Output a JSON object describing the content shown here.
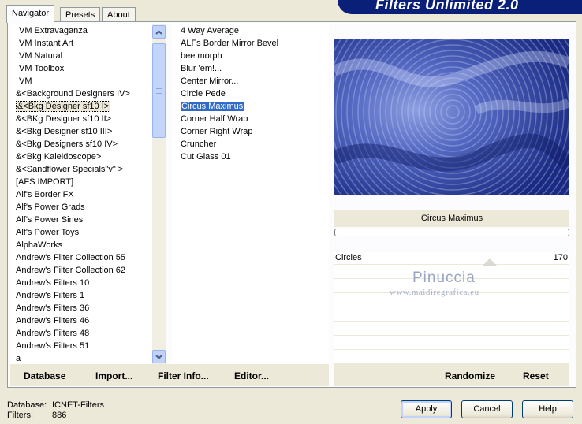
{
  "tabs": [
    {
      "label": "Navigator",
      "active": true
    },
    {
      "label": "Presets",
      "active": false
    },
    {
      "label": "About",
      "active": false
    }
  ],
  "banner": {
    "title": "Filters Unlimited 2.0"
  },
  "categories": [
    "VM Extravaganza",
    "VM Instant Art",
    "VM Natural",
    "VM Toolbox",
    "VM",
    "&<Background Designers IV>",
    "&<Bkg Designer sf10 I>",
    "&<BKg Designer sf10 II>",
    "&<Bkg Designer sf10 III>",
    "&<Bkg Designers sf10 IV>",
    "&<Bkg Kaleidoscope>",
    "&<Sandflower Specials\"v\" >",
    "[AFS IMPORT]",
    "Alf's Border FX",
    "Alf's Power Grads",
    "Alf's Power Sines",
    "Alf's Power Toys",
    "AlphaWorks",
    "Andrew's Filter Collection 55",
    "Andrew's Filter Collection 62",
    "Andrew's Filters 10",
    "Andrew's Filters 1",
    "Andrew's Filters 36",
    "Andrew's Filters 46",
    "Andrew's Filters 48",
    "Andrew's Filters 51",
    "a"
  ],
  "selected_category": "&<Bkg Designer sf10 I>",
  "filters": [
    "4 Way Average",
    "ALFs Border Mirror Bevel",
    "bee morph",
    "Blur 'em!...",
    "Center Mirror...",
    "Circle Pede",
    "Circus Maximus",
    "Corner Half Wrap",
    "Corner Right Wrap",
    "Cruncher",
    "Cut Glass 01"
  ],
  "selected_filter": "Circus Maximus",
  "preview": {
    "filter_name": "Circus Maximus"
  },
  "params": [
    {
      "name": "Circles",
      "value": "170"
    }
  ],
  "watermark": {
    "line1": "Pinuccia",
    "line2": "www.maidiregrafica.eu"
  },
  "actions": {
    "database": "Database",
    "import": "Import...",
    "filter_info": "Filter Info...",
    "editor": "Editor...",
    "randomize": "Randomize",
    "reset": "Reset"
  },
  "info": {
    "database_label": "Database:",
    "database_value": "ICNET-Filters",
    "filters_label": "Filters:",
    "filters_value": "886"
  },
  "buttons": {
    "apply": "Apply",
    "cancel": "Cancel",
    "help": "Help"
  },
  "colors": {
    "selection": "#316ac5",
    "banner": "#0a1f78",
    "preview_base": "#1b2c86"
  }
}
